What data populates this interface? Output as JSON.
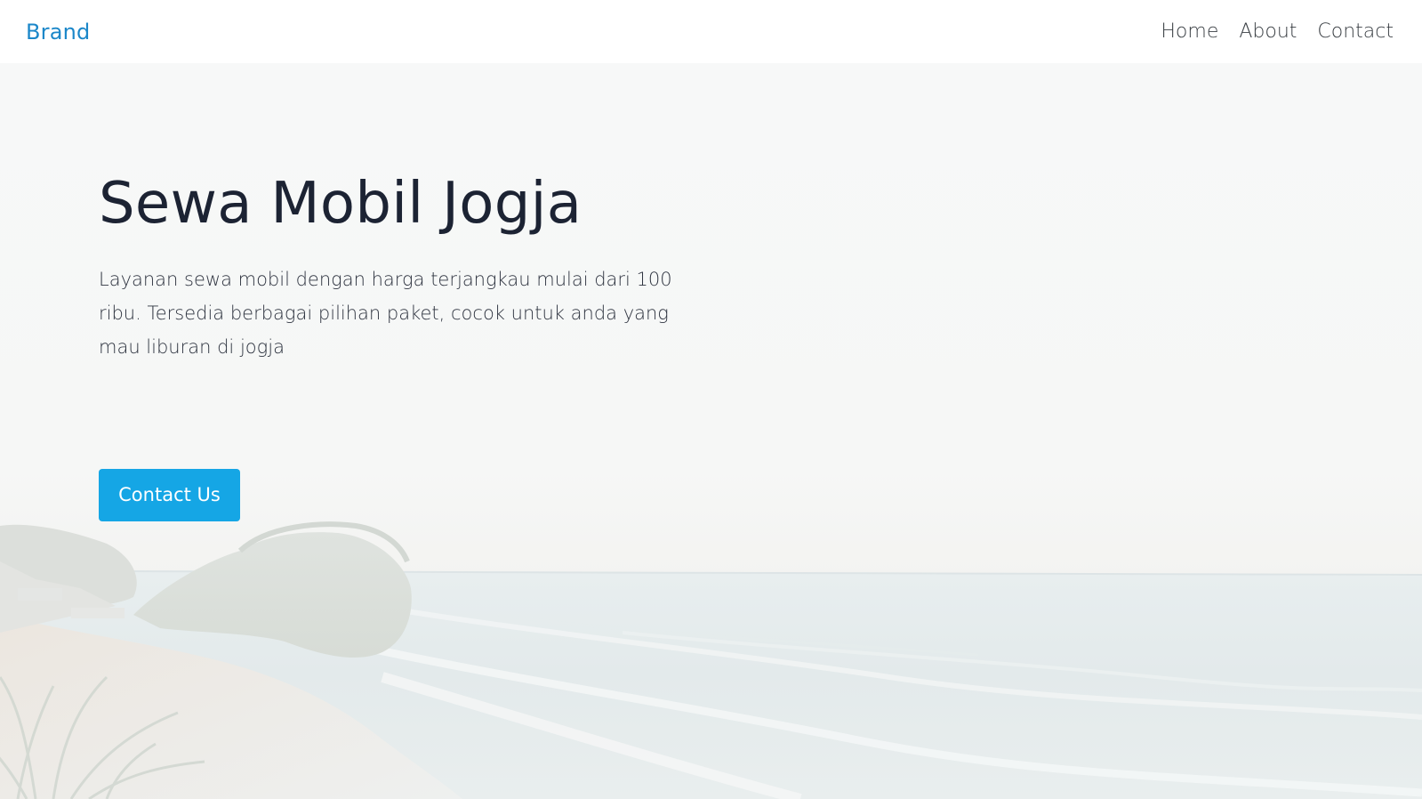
{
  "navbar": {
    "brand": "Brand",
    "links": [
      "Home",
      "About",
      "Contact"
    ]
  },
  "hero": {
    "title": "Sewa Mobil Jogja",
    "description": "Layanan sewa mobil dengan harga terjangkau mulai dari 100 ribu. Tersedia berbagai pilihan paket, cocok untuk anda yang mau liburan di jogja",
    "cta_label": "Contact Us",
    "background": "beach-seascape-image"
  },
  "colors": {
    "brand": "#1b87c9",
    "button": "#15a6e5",
    "title": "#1c2333",
    "text": "#2e3440",
    "nav_text": "#3a3f44"
  }
}
